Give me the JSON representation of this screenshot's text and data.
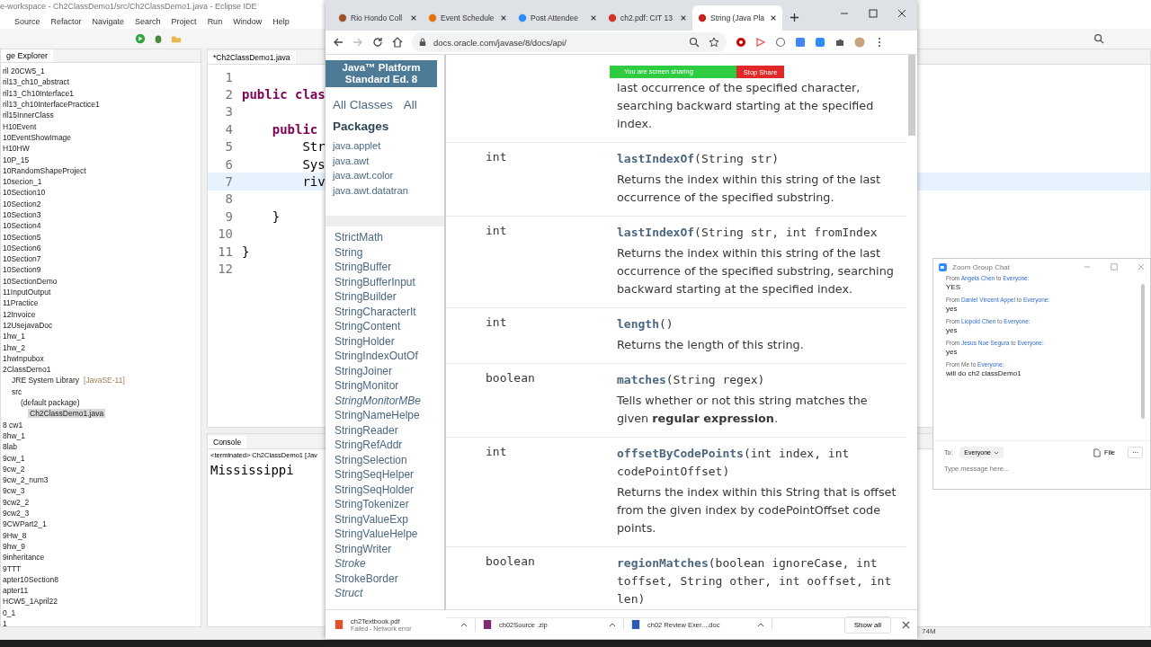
{
  "eclipse": {
    "title": "e-workspace - Ch2ClassDemo1/src/Ch2ClassDemo1.java - Eclipse IDE",
    "menu": [
      "Source",
      "Refactor",
      "Navigate",
      "Search",
      "Project",
      "Run",
      "Window",
      "Help"
    ],
    "explorer": {
      "title": "ge Explorer",
      "items": [
        {
          "label": "ril 20CW5_1",
          "selected": false
        },
        {
          "label": "ril13_ch10_abstract",
          "selected": false
        },
        {
          "label": "ril13_Ch10Interface1",
          "selected": false
        },
        {
          "label": "ril13_ch10InterfacePractice1",
          "selected": false
        },
        {
          "label": "ril15InnerClass",
          "selected": false
        },
        {
          "label": "H10Event",
          "selected": false
        },
        {
          "label": "10EventShowImage",
          "selected": false
        },
        {
          "label": "H10HW",
          "selected": false
        },
        {
          "label": "10P_15",
          "selected": false
        },
        {
          "label": "10RandomShapeProject",
          "selected": false
        },
        {
          "label": "10secion_1",
          "selected": false
        },
        {
          "label": "10Section10",
          "selected": false
        },
        {
          "label": "10Section2",
          "selected": false
        },
        {
          "label": "10Section3",
          "selected": false
        },
        {
          "label": "10Section4",
          "selected": false
        },
        {
          "label": "10Section5",
          "selected": false
        },
        {
          "label": "10Section6",
          "selected": false
        },
        {
          "label": "10Section7",
          "selected": false
        },
        {
          "label": "10Section9",
          "selected": false
        },
        {
          "label": "10SectionDemo",
          "selected": false
        },
        {
          "label": "11InputOutput",
          "selected": false
        },
        {
          "label": "11Practice",
          "selected": false
        },
        {
          "label": "12Invoice",
          "selected": false
        },
        {
          "label": "12UsejavaDoc",
          "selected": false
        },
        {
          "label": "1hw_1",
          "selected": false
        },
        {
          "label": "1hw_2",
          "selected": false
        },
        {
          "label": "1hwInpubox",
          "selected": false
        },
        {
          "label": "2ClassDemo1",
          "selected": false,
          "children": [
            {
              "label": "JRE System Library",
              "tag": "[JavaSE-11]",
              "selected": false
            },
            {
              "label": "src",
              "selected": false,
              "children": [
                {
                  "label": "(default package)",
                  "selected": false,
                  "children": [
                    {
                      "label": "Ch2ClassDemo1.java",
                      "selected": true
                    }
                  ]
                }
              ]
            }
          ]
        },
        {
          "label": "8 cw1",
          "selected": false
        },
        {
          "label": "8hw_1",
          "selected": false
        },
        {
          "label": "8lab",
          "selected": false
        },
        {
          "label": "9cw_1",
          "selected": false
        },
        {
          "label": "9cw_2",
          "selected": false
        },
        {
          "label": "9cw_2_num3",
          "selected": false
        },
        {
          "label": "9cw_3",
          "selected": false
        },
        {
          "label": "9cw2_2",
          "selected": false
        },
        {
          "label": "9cw2_3",
          "selected": false
        },
        {
          "label": "9CWPart2_1",
          "selected": false
        },
        {
          "label": "9Hw_8",
          "selected": false
        },
        {
          "label": "9hw_9",
          "selected": false
        },
        {
          "label": "9inheritance",
          "selected": false
        },
        {
          "label": "9TTT",
          "selected": false
        },
        {
          "label": "apter10Section8",
          "selected": false
        },
        {
          "label": "apter11",
          "selected": false
        },
        {
          "label": "HCW5_1April22",
          "selected": false
        },
        {
          "label": "0_1",
          "selected": false
        },
        {
          "label": "1",
          "selected": false
        }
      ]
    },
    "editor": {
      "tab": "*Ch2ClassDemo1.java",
      "lines": [
        {
          "number": "1",
          "current": false
        },
        {
          "number": "2",
          "code": "public clas",
          "kind": "keyword",
          "current": false
        },
        {
          "number": "3",
          "current": false
        },
        {
          "number": "4",
          "code": "    public",
          "kind": "keyword",
          "current": false
        },
        {
          "number": "5",
          "code": "        Str",
          "kind": "plain",
          "current": false
        },
        {
          "number": "6",
          "code": "        Sys",
          "kind": "plain",
          "current": false
        },
        {
          "number": "7",
          "code": "        riv",
          "kind": "plain",
          "current": true
        },
        {
          "number": "8",
          "current": false
        },
        {
          "number": "9",
          "code": "    }",
          "kind": "plain",
          "current": false
        },
        {
          "number": "10",
          "current": false
        },
        {
          "number": "11",
          "code": "}",
          "kind": "plain",
          "current": false
        },
        {
          "number": "12",
          "current": false
        }
      ]
    },
    "console": {
      "title": "Console",
      "status": "<terminated> Ch2ClassDemo1 [Jav",
      "output": "Mississippi"
    },
    "memory": "74M"
  },
  "browser": {
    "tabs": [
      {
        "label": "Rio Hondo Coll",
        "selected": false,
        "color": "#a0522d"
      },
      {
        "label": "Event Schedule",
        "selected": false,
        "color": "#e8710a"
      },
      {
        "label": "Post Attendee",
        "selected": false,
        "color": "#2d8cff"
      },
      {
        "label": "ch2.pdf: CIT 13",
        "selected": false,
        "color": "#d93025"
      },
      {
        "label": "String (Java Pla",
        "selected": true,
        "color": "#c5221f"
      }
    ],
    "url": "docs.oracle.com/javase/8/docs/api/",
    "screen_share": {
      "status": "You are screen sharing",
      "button": "Stop Share"
    },
    "javadoc": {
      "frame_title": "Java™ Platform Standard Ed. 8",
      "nav": [
        "All Classes",
        "All"
      ],
      "packages_heading": "Packages",
      "packages": [
        "java.applet",
        "java.awt",
        "java.awt.color",
        "java.awt.datatran"
      ],
      "classes": [
        {
          "name": "StrictMath",
          "interface": false
        },
        {
          "name": "String",
          "interface": false
        },
        {
          "name": "StringBuffer",
          "interface": false
        },
        {
          "name": "StringBufferInput",
          "interface": false
        },
        {
          "name": "StringBuilder",
          "interface": false
        },
        {
          "name": "StringCharacterIt",
          "interface": false
        },
        {
          "name": "StringContent",
          "interface": false
        },
        {
          "name": "StringHolder",
          "interface": false
        },
        {
          "name": "StringIndexOutOf",
          "interface": false
        },
        {
          "name": "StringJoiner",
          "interface": false
        },
        {
          "name": "StringMonitor",
          "interface": false
        },
        {
          "name": "StringMonitorMBe",
          "interface": true
        },
        {
          "name": "StringNameHelpe",
          "interface": false
        },
        {
          "name": "StringReader",
          "interface": false
        },
        {
          "name": "StringRefAddr",
          "interface": false
        },
        {
          "name": "StringSelection",
          "interface": false
        },
        {
          "name": "StringSeqHelper",
          "interface": false
        },
        {
          "name": "StringSeqHolder",
          "interface": false
        },
        {
          "name": "StringTokenizer",
          "interface": false
        },
        {
          "name": "StringValueExp",
          "interface": false
        },
        {
          "name": "StringValueHelpe",
          "interface": false
        },
        {
          "name": "StringWriter",
          "interface": false
        },
        {
          "name": "Stroke",
          "interface": true
        },
        {
          "name": "StrokeBorder",
          "interface": false
        },
        {
          "name": "Struct",
          "interface": true
        }
      ],
      "methods": [
        {
          "description": "last occurrence of the specified character, searching backward starting at the specified index."
        },
        {
          "type": "int",
          "signature": "**lastIndexOf**(String str)",
          "description": "Returns the index within this string of the last occurrence of the specified substring."
        },
        {
          "type": "int",
          "signature": "**lastIndexOf**(String str, int fromIndex",
          "description": "Returns the index within this string of the last occurrence of the specified substring, searching backward starting at the specified index."
        },
        {
          "type": "int",
          "signature": "**length**()",
          "description": "Returns the length of this string."
        },
        {
          "type": "boolean",
          "signature": "**matches**(String regex)",
          "description": "Tells whether or not this string matches the given **regular expression**."
        },
        {
          "type": "int",
          "signature": "**offsetByCodePoints**(int index, int codePointOffset)",
          "description": "Returns the index within this String that is offset from the given index by codePointOffset code points."
        },
        {
          "type": "boolean",
          "signature": "**regionMatches**(boolean ignoreCase, int toffset, String other, int ooffset, int len)"
        }
      ]
    },
    "downloads": [
      {
        "name": "ch2Textbook.pdf",
        "status": "Failed - Network error",
        "kind": "pdf"
      },
      {
        "name": "ch02Source .zip",
        "kind": "zip"
      },
      {
        "name": "ch02  Review Exer....doc",
        "kind": "doc"
      }
    ],
    "show_all": "Show all"
  },
  "chat": {
    "title": "Zoom Group Chat",
    "messages": [
      {
        "from": "From",
        "sender": "Angela Chen",
        "sender_highlighted": true,
        "to": "to",
        "recipient": "Everyone:",
        "text": "YES"
      },
      {
        "from": "From",
        "sender": "Daniel Vincent Appel",
        "sender_highlighted": true,
        "to": "to",
        "recipient": "Everyone:",
        "text": "yes"
      },
      {
        "from": "From",
        "sender": "Liopold Chen",
        "sender_highlighted": true,
        "to": "to",
        "recipient": "Everyone:",
        "text": "yes"
      },
      {
        "from": "From",
        "sender": "Jesus Noe Segura",
        "sender_highlighted": true,
        "to": "to",
        "recipient": "Everyone:",
        "text": "yes"
      },
      {
        "from": "From",
        "sender": "Me",
        "sender_highlighted": false,
        "to": "to",
        "recipient": "Everyone:",
        "text": "will do ch2  classDemo1"
      }
    ],
    "to_label": "To:",
    "recipient": "Everyone",
    "file": "File",
    "more": "···",
    "placeholder": "Type message here..."
  }
}
